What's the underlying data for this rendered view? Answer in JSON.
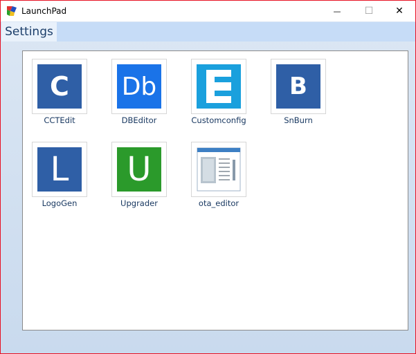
{
  "window": {
    "title": "LaunchPad",
    "controls": {
      "minimize": "—",
      "maximize": "☐",
      "close": "✕"
    }
  },
  "menu": {
    "settings_label": "Settings"
  },
  "apps": [
    {
      "label": "CCTEdit",
      "glyph": "C",
      "bg": "#2f5fa6",
      "icon": "cctedit-icon"
    },
    {
      "label": "DBEditor",
      "glyph": "Db",
      "bg": "#1a73e8",
      "icon": "dbeditor-icon"
    },
    {
      "label": "Customconfig",
      "glyph": "E",
      "bg": "#1aa0dd",
      "icon": "customconfig-icon"
    },
    {
      "label": "SnBurn",
      "glyph": "B",
      "bg": "#2f5fa6",
      "icon": "snburn-icon"
    },
    {
      "label": "LogoGen",
      "glyph": "L",
      "bg": "#2f5fa6",
      "icon": "logogen-icon"
    },
    {
      "label": "Upgrader",
      "glyph": "U",
      "bg": "#2b9a2b",
      "icon": "upgrader-icon"
    },
    {
      "label": "ota_editor",
      "glyph": "",
      "bg": "#ffffff",
      "icon": "ota-editor-window-icon"
    }
  ]
}
